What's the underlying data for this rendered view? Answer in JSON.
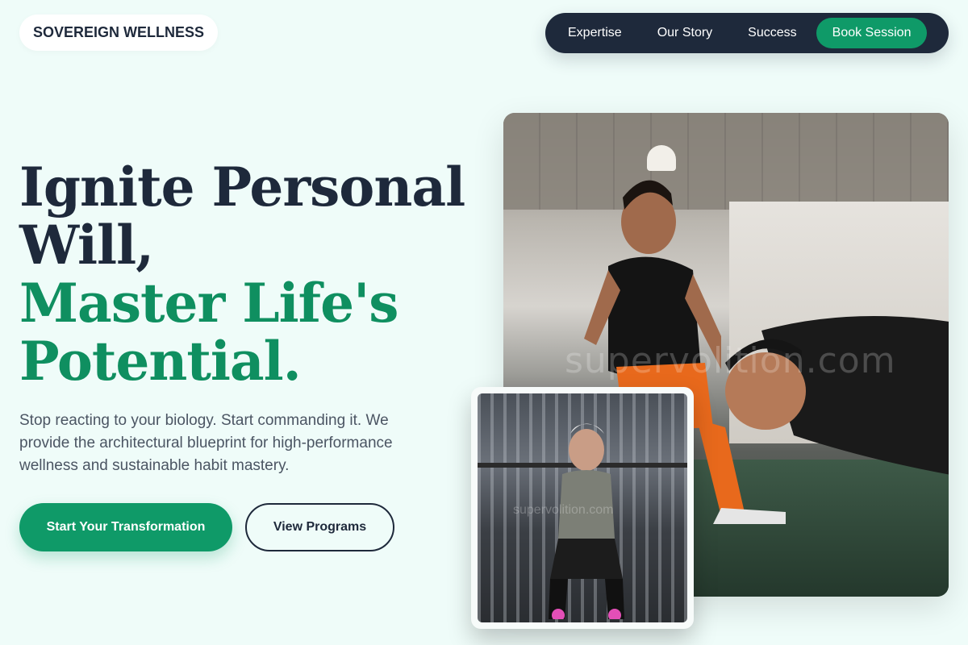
{
  "brand": {
    "name": "SOVEREIGN WELLNESS"
  },
  "nav": {
    "items": [
      "Expertise",
      "Our Story",
      "Success"
    ],
    "cta": "Book Session"
  },
  "hero": {
    "headline_line1": "Ignite Personal",
    "headline_line2": "Will,",
    "headline_line3": "Master Life's",
    "headline_line4": "Potential.",
    "subtitle": "Stop reacting to your biology. Start commanding it. We provide the architectural blueprint for high-performance wellness and sustainable habit mastery.",
    "primary_button": "Start Your Transformation",
    "secondary_button": "View Programs"
  },
  "images": {
    "hero_watermark": "supervolition.com",
    "inset_watermark": "supervolition.com"
  },
  "colors": {
    "background": "#effcf9",
    "navy": "#1e293b",
    "accent_green": "#0f9a68"
  }
}
